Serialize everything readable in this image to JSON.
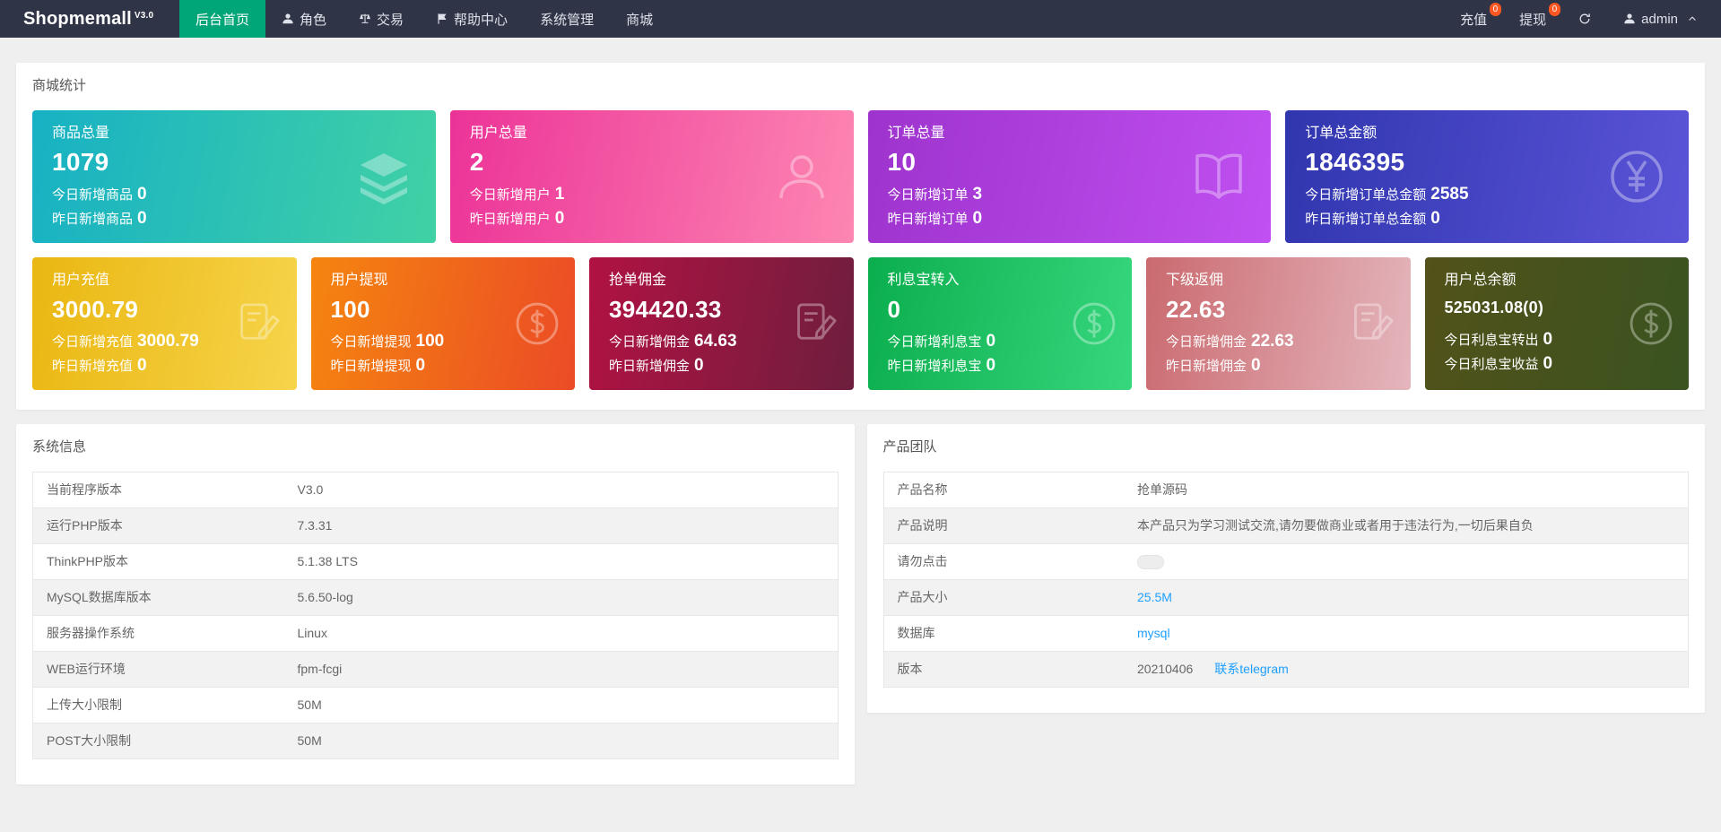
{
  "theme": {
    "header_bg": "#2f3447",
    "active_nav_bg": "#00a578",
    "badge_bg": "#ff5722",
    "link_color": "#1e9fff",
    "page_bg": "#efefef"
  },
  "header": {
    "logo": "Shopmemall",
    "logo_version": "V3.0",
    "nav": [
      {
        "label": "后台首页"
      },
      {
        "label": "角色",
        "icon": "user-icon"
      },
      {
        "label": "交易",
        "icon": "scales-icon"
      },
      {
        "label": "帮助中心",
        "icon": "flag-icon"
      },
      {
        "label": "系统管理"
      },
      {
        "label": "商城"
      }
    ],
    "right": {
      "recharge": {
        "label": "充值",
        "badge": "0"
      },
      "withdraw": {
        "label": "提现",
        "badge": "0"
      },
      "refresh_icon": "refresh-icon",
      "user": {
        "label": "admin",
        "icon": "user-icon"
      }
    }
  },
  "stats": {
    "title": "商城统计",
    "row1": [
      {
        "title": "商品总量",
        "value": "1079",
        "today_label": "今日新增商品",
        "today_value": "0",
        "yesterday_label": "昨日新增商品",
        "yesterday_value": "0",
        "icon": "layers-icon",
        "gradient": [
          "#17b1c4",
          "#41d1a5"
        ]
      },
      {
        "title": "用户总量",
        "value": "2",
        "today_label": "今日新增用户",
        "today_value": "1",
        "yesterday_label": "昨日新增用户",
        "yesterday_value": "0",
        "icon": "user-icon",
        "gradient": [
          "#ec3398",
          "#fd86b2"
        ]
      },
      {
        "title": "订单总量",
        "value": "10",
        "today_label": "今日新增订单",
        "today_value": "3",
        "yesterday_label": "昨日新增订单",
        "yesterday_value": "0",
        "icon": "book-icon",
        "gradient": [
          "#9e33cd",
          "#c050f1"
        ]
      },
      {
        "title": "订单总金额",
        "value": "1846395",
        "today_label": "今日新增订单总金额",
        "today_value": "2585",
        "yesterday_label": "昨日新增订单总金额",
        "yesterday_value": "0",
        "icon": "yen-icon",
        "gradient": [
          "#3036ae",
          "#5b54d8"
        ]
      }
    ],
    "row2": [
      {
        "title": "用户充值",
        "value": "3000.79",
        "today_label": "今日新增充值",
        "today_value": "3000.79",
        "yesterday_label": "昨日新增充值",
        "yesterday_value": "0",
        "icon": "doc-edit-icon",
        "gradient": [
          "#eab712",
          "#f6d44a"
        ]
      },
      {
        "title": "用户提现",
        "value": "100",
        "today_label": "今日新增提现",
        "today_value": "100",
        "yesterday_label": "昨日新增提现",
        "yesterday_value": "0",
        "icon": "dollar-icon",
        "gradient": [
          "#f5850f",
          "#eb4b26"
        ]
      },
      {
        "title": "抢单佣金",
        "value": "394420.33",
        "today_label": "今日新增佣金",
        "today_value": "64.63",
        "yesterday_label": "昨日新增佣金",
        "yesterday_value": "0",
        "icon": "doc-edit-icon",
        "gradient": [
          "#b11243",
          "#6e1e3d"
        ]
      },
      {
        "title": "利息宝转入",
        "value": "0",
        "today_label": "今日新增利息宝",
        "today_value": "0",
        "yesterday_label": "昨日新增利息宝",
        "yesterday_value": "0",
        "icon": "dollar-icon",
        "gradient": [
          "#0bae4d",
          "#37d77e"
        ]
      },
      {
        "title": "下级返佣",
        "value": "22.63",
        "today_label": "今日新增佣金",
        "today_value": "22.63",
        "yesterday_label": "昨日新增佣金",
        "yesterday_value": "0",
        "icon": "doc-edit-icon",
        "gradient": [
          "#ca6a6f",
          "#e4b6bd"
        ]
      },
      {
        "title": "用户总余额",
        "value": "525031.08(0)",
        "today_label": "今日利息宝转出",
        "today_value": "0",
        "yesterday_label": "今日利息宝收益",
        "yesterday_value": "0",
        "icon": "dollar-icon",
        "gradient": [
          "#52521a",
          "#3a5320"
        ]
      }
    ]
  },
  "system_info": {
    "title": "系统信息",
    "rows": [
      [
        "当前程序版本",
        "V3.0"
      ],
      [
        "运行PHP版本",
        "7.3.31"
      ],
      [
        "ThinkPHP版本",
        "5.1.38 LTS"
      ],
      [
        "MySQL数据库版本",
        "5.6.50-log"
      ],
      [
        "服务器操作系统",
        "Linux"
      ],
      [
        "WEB运行环境",
        "fpm-fcgi"
      ],
      [
        "上传大小限制",
        "50M"
      ],
      [
        "POST大小限制",
        "50M"
      ]
    ]
  },
  "product_team": {
    "title": "产品团队",
    "rows": [
      {
        "label": "产品名称",
        "value": "抢单源码"
      },
      {
        "label": "产品说明",
        "value": "本产品只为学习测试交流,请勿要做商业或者用于违法行为,一切后果自负"
      },
      {
        "label": "请勿点击",
        "value": ""
      },
      {
        "label": "产品大小",
        "value": "25.5M"
      },
      {
        "label": "数据库",
        "value": "mysql"
      },
      {
        "label": "版本",
        "value": "20210406",
        "extra": "联系telegram"
      }
    ]
  }
}
